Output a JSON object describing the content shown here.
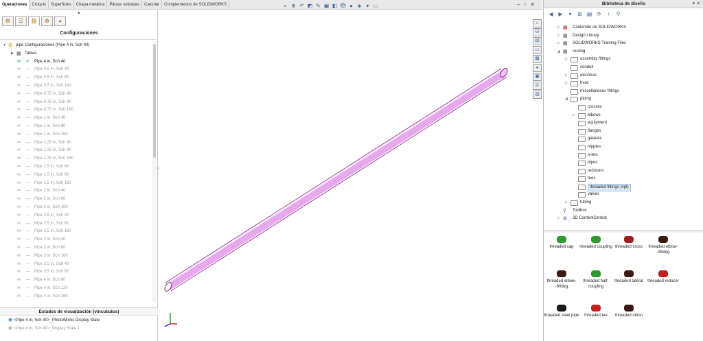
{
  "tabs": [
    "Operaciones",
    "Croquis",
    "Superficies",
    "Chapa metálica",
    "Piezas soldadas",
    "Calcular",
    "Complementos de SOLIDWORKS"
  ],
  "active_tab": "Operaciones",
  "left_panel": {
    "title": "Configuraciones",
    "root_label": "pipe Configuraciones  (Pipe 4 in, Sch 40)",
    "tables_label": "Tablas",
    "configs": [
      "Pipe 4 in, Sch 40",
      "Pipe 0.5 in, Sch 40",
      "Pipe 0.5 in, Sch 80",
      "Pipe 0.5 in, Sch 160",
      "Pipe 0.75 in, Sch 40",
      "Pipe 0.75 in, Sch 80",
      "Pipe 0.75 in, Sch 160",
      "Pipe 1 in, Sch 40",
      "Pipe 1 in, Sch 80",
      "Pipe 1 in, Sch 160",
      "Pipe 1.25 in, Sch 40",
      "Pipe 1.25 in, Sch 80",
      "Pipe 1.25 in, Sch 160",
      "Pipe 1.5 in, Sch 40",
      "Pipe 1.5 in, Sch 80",
      "Pipe 1.5 in, Sch 160",
      "Pipe 2 in, Sch 40",
      "Pipe 2 in, Sch 80",
      "Pipe 2 in, Sch 160",
      "Pipe 2.5 in, Sch 40",
      "Pipe 2.5 in, Sch 80",
      "Pipe 2.5 in, Sch 160",
      "Pipe 3 in, Sch 40",
      "Pipe 3 in, Sch 80",
      "Pipe 3 in, Sch 160",
      "Pipe 3.5 in, Sch 40",
      "Pipe 3.5 in, Sch 80",
      "Pipe 4 in, Sch 80",
      "Pipe 4 in, Sch 120",
      "Pipe 4 in, Sch 160"
    ],
    "display_states_title": "Estados de visualización (vinculados)",
    "display_states": [
      "<Pipe 4 in, Sch 40>_PhotoWorks Display State",
      "<Pipe 4 in, Sch 40>_Display State 1"
    ]
  },
  "right_panel": {
    "title": "Biblioteca de diseño",
    "tree": [
      {
        "label": "Contenido de SOLIDWORKS",
        "level": 0,
        "kind": "special",
        "expand": "right"
      },
      {
        "label": "Design Library",
        "level": 0,
        "kind": "special",
        "expand": "right"
      },
      {
        "label": "SOLIDWORKS Training Files",
        "level": 0,
        "kind": "special",
        "expand": "right"
      },
      {
        "label": "routing",
        "level": 0,
        "kind": "special",
        "expand": "down"
      },
      {
        "label": "assembly fittings",
        "level": 1,
        "kind": "folder",
        "expand": "right"
      },
      {
        "label": "conduit",
        "level": 1,
        "kind": "folder",
        "expand": ""
      },
      {
        "label": "electrical",
        "level": 1,
        "kind": "folder",
        "expand": "right"
      },
      {
        "label": "hvac",
        "level": 1,
        "kind": "folder",
        "expand": "right"
      },
      {
        "label": "miscellaneous fittings",
        "level": 1,
        "kind": "folder",
        "expand": ""
      },
      {
        "label": "piping",
        "level": 1,
        "kind": "folder",
        "expand": "down"
      },
      {
        "label": "crosses",
        "level": 2,
        "kind": "folder",
        "expand": ""
      },
      {
        "label": "elbows",
        "level": 2,
        "kind": "folder",
        "expand": "right"
      },
      {
        "label": "equipment",
        "level": 2,
        "kind": "folder",
        "expand": ""
      },
      {
        "label": "flanges",
        "level": 2,
        "kind": "folder",
        "expand": ""
      },
      {
        "label": "gaskets",
        "level": 2,
        "kind": "folder",
        "expand": ""
      },
      {
        "label": "nipples",
        "level": 2,
        "kind": "folder",
        "expand": ""
      },
      {
        "label": "o-lets",
        "level": 2,
        "kind": "folder",
        "expand": ""
      },
      {
        "label": "pipes",
        "level": 2,
        "kind": "folder",
        "expand": ""
      },
      {
        "label": "reducers",
        "level": 2,
        "kind": "folder",
        "expand": ""
      },
      {
        "label": "tees",
        "level": 2,
        "kind": "folder",
        "expand": ""
      },
      {
        "label": "threaded fittings (npt)",
        "level": 2,
        "kind": "folder",
        "expand": "",
        "selected": true
      },
      {
        "label": "valves",
        "level": 2,
        "kind": "folder",
        "expand": ""
      },
      {
        "label": "tubing",
        "level": 1,
        "kind": "folder",
        "expand": "right"
      },
      {
        "label": "Toolbox",
        "level": 0,
        "kind": "toolbox",
        "expand": ""
      },
      {
        "label": "3D ContentCentral",
        "level": 0,
        "kind": "globe",
        "expand": "right"
      }
    ],
    "items": [
      {
        "label": "threaded cap",
        "color": "#2e9a2e"
      },
      {
        "label": "threaded coupling",
        "color": "#2e9a2e"
      },
      {
        "label": "threaded cross",
        "color": "#9a1f1f"
      },
      {
        "label": "threaded elbow--45deg",
        "color": "#3a1a10"
      },
      {
        "label": "threaded elbow--90deg",
        "color": "#3a1a10"
      },
      {
        "label": "threaded half-coupling",
        "color": "#2e9a2e"
      },
      {
        "label": "threaded lateral",
        "color": "#3a1a10"
      },
      {
        "label": "threaded reducer",
        "color": "#c22020"
      },
      {
        "label": "threaded steel pipe",
        "color": "#1a1a1a"
      },
      {
        "label": "threaded tee",
        "color": "#c22020"
      },
      {
        "label": "threaded union",
        "color": "#3a1a10"
      }
    ]
  },
  "pipe_color": "#e8a8ee"
}
